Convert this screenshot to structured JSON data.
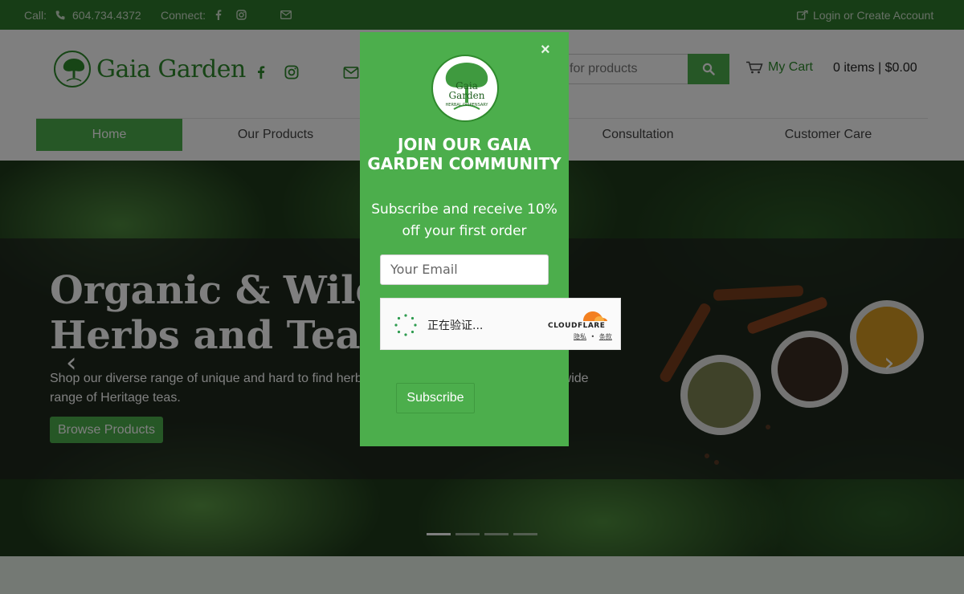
{
  "topbar": {
    "call_label": "Call:",
    "phone": "604.734.4372",
    "connect_label": "Connect:",
    "account_link": "Login or Create Account"
  },
  "header": {
    "brand": "Gaia Garden",
    "search_placeholder": "for products",
    "cart_label": "My Cart",
    "cart_summary": "0 items | $0.00"
  },
  "nav": {
    "items": [
      {
        "label": "Home",
        "active": true
      },
      {
        "label": "Our Products",
        "active": false
      },
      {
        "label": "",
        "active": false
      },
      {
        "label": "Consultation",
        "active": false
      },
      {
        "label": "Customer Care",
        "active": false
      }
    ]
  },
  "hero": {
    "title_line1": "Organic & Wild",
    "title_line2": "Herbs and Teas",
    "description": "Shop our diverse range of unique and hard to find herb                                                        wide range of Heritage teas.",
    "button": "Browse Products",
    "prev_arrow": "‹",
    "next_arrow": "›",
    "slides": 4,
    "active_slide": 1
  },
  "popup": {
    "close": "×",
    "logo_line1": "Gaia",
    "logo_line2": "Garden",
    "logo_line3": "HERBAL DISPENSARY",
    "title": "JOIN OUR GAIA GARDEN COMMUNITY",
    "subtitle": "Subscribe and receive 10% off your first order",
    "email_placeholder": "Your Email",
    "subscribe": "Subscribe"
  },
  "captcha": {
    "status": "正在验证...",
    "brand": "CLOUDFLARE",
    "privacy": "隐私",
    "separator": "•",
    "terms": "条款"
  },
  "colors": {
    "topbar": "#2f7a2c",
    "brand_green": "#2f8a2d",
    "accent": "#4cae4c"
  }
}
